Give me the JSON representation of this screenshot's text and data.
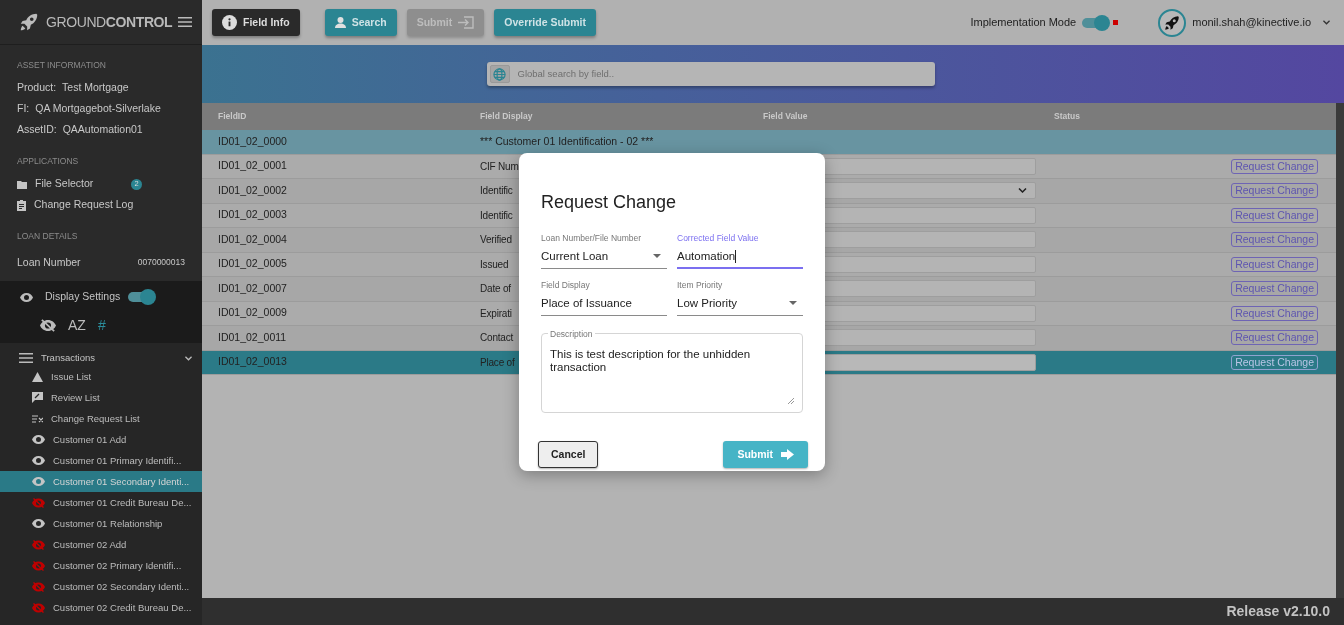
{
  "sidebar": {
    "logo": "GROUND**CONTROL**",
    "asset_information": {
      "heading": "ASSET INFORMATION",
      "rows": [
        {
          "label": "Product:",
          "value": "Test Mortgage"
        },
        {
          "label": "FI:",
          "value": "QA Mortgagebot-Silverlake"
        },
        {
          "label": "AssetID:",
          "value": "QAAutomation01"
        }
      ]
    },
    "applications": {
      "heading": "APPLICATIONS",
      "items": [
        {
          "kind": "folder",
          "label": "File Selector",
          "badge": "2"
        },
        {
          "kind": "clipboard",
          "label": "Change Request Log"
        }
      ]
    },
    "loan_details": {
      "heading": "LOAN DETAILS",
      "label": "Loan Number",
      "value": "0070000013"
    },
    "display_settings": {
      "label": "Display Settings",
      "on": true,
      "tools": [
        {
          "kind": "hide",
          "selected": false
        },
        {
          "kind": "text",
          "label": "AZ",
          "selected": false
        },
        {
          "kind": "text",
          "label": "#",
          "selected": true
        }
      ]
    },
    "transactions": {
      "label": "Transactions",
      "expanded": true,
      "items": [
        {
          "kind": "issue",
          "label": "Issue List",
          "selected": false
        },
        {
          "kind": "review",
          "label": "Review List",
          "selected": false
        },
        {
          "kind": "change",
          "label": "Change Request List",
          "selected": false
        },
        {
          "kind": "transaction",
          "label": "Customer 01 Add",
          "hidden": false,
          "selected": false
        },
        {
          "kind": "transaction",
          "label": "Customer 01 Primary Identifi...",
          "hidden": false,
          "selected": false
        },
        {
          "kind": "transaction",
          "label": "Customer 01 Secondary Identi...",
          "hidden": false,
          "selected": true
        },
        {
          "kind": "transaction",
          "label": "Customer 01 Credit Bureau De...",
          "hidden": true,
          "selected": false
        },
        {
          "kind": "transaction",
          "label": "Customer 01 Relationship",
          "hidden": false,
          "selected": false
        },
        {
          "kind": "transaction",
          "label": "Customer 02 Add",
          "hidden": true,
          "selected": false
        },
        {
          "kind": "transaction",
          "label": "Customer 02 Primary Identifi...",
          "hidden": true,
          "selected": false
        },
        {
          "kind": "transaction",
          "label": "Customer 02 Secondary Identi...",
          "hidden": true,
          "selected": false
        },
        {
          "kind": "transaction",
          "label": "Customer 02 Credit Bureau De...",
          "hidden": true,
          "selected": false
        }
      ]
    }
  },
  "top_bar": {
    "buttons": [
      {
        "kind": "info",
        "label": "Field Info",
        "disabled": false
      },
      {
        "kind": "search",
        "label": "Search",
        "disabled": false
      },
      {
        "kind": "submit",
        "label": "Submit",
        "disabled": true
      },
      {
        "kind": "plain",
        "label": "Override Submit",
        "disabled": false
      }
    ],
    "implementation_mode": {
      "label": "Implementation Mode",
      "on": true
    },
    "user": {
      "email": "monil.shah@kinective.io"
    }
  },
  "search": {
    "placeholder": "Global search by field.."
  },
  "table": {
    "columns": [
      "FieldID",
      "Field Display",
      "Field Value",
      "Status"
    ],
    "rows": [
      {
        "kind": "section",
        "field_id": "ID01_02_0000",
        "field_display": "*** Customer 01 Identification - 02 ***",
        "selected": false
      },
      {
        "kind": "text",
        "field_id": "ID01_02_0001",
        "field_display": "CIF Num",
        "action": "Request Change",
        "selected": false
      },
      {
        "kind": "select",
        "field_id": "ID01_02_0002",
        "field_display": "Identific",
        "action": "Request Change",
        "selected": false
      },
      {
        "kind": "text",
        "field_id": "ID01_02_0003",
        "field_display": "Identific",
        "action": "Request Change",
        "selected": false
      },
      {
        "kind": "text",
        "field_id": "ID01_02_0004",
        "field_display": "Verified",
        "action": "Request Change",
        "selected": false
      },
      {
        "kind": "text",
        "field_id": "ID01_02_0005",
        "field_display": "Issued",
        "action": "Request Change",
        "selected": false
      },
      {
        "kind": "text",
        "field_id": "ID01_02_0007",
        "field_display": "Date of",
        "action": "Request Change",
        "selected": false
      },
      {
        "kind": "text",
        "field_id": "ID01_02_0009",
        "field_display": "Expirati",
        "action": "Request Change",
        "selected": false
      },
      {
        "kind": "text",
        "field_id": "ID01_02_0011",
        "field_display": "Contact",
        "action": "Request Change",
        "selected": false
      },
      {
        "kind": "text",
        "field_id": "ID01_02_0013",
        "field_display": "Place of",
        "action": "Request Change",
        "selected": true
      }
    ]
  },
  "modal": {
    "title": "Request Change",
    "fields": [
      {
        "kind": "select",
        "label": "Loan Number/File Number",
        "value": "Current Loan",
        "focused": false
      },
      {
        "kind": "text",
        "label": "Corrected Field Value",
        "value": "Automation",
        "focused": true
      },
      {
        "kind": "text",
        "label": "Field Display",
        "value": "Place of Issuance",
        "focused": false
      },
      {
        "kind": "select",
        "label": "Item Priority",
        "value": "Low Priority",
        "focused": false
      }
    ],
    "description": {
      "label": "Description",
      "value": "This is test description for the unhidden transaction"
    },
    "buttons": [
      {
        "kind": "cancel",
        "label": "Cancel"
      },
      {
        "kind": "submit",
        "label": "Submit"
      }
    ]
  },
  "footer": {
    "release": "Release v2.10.0"
  }
}
